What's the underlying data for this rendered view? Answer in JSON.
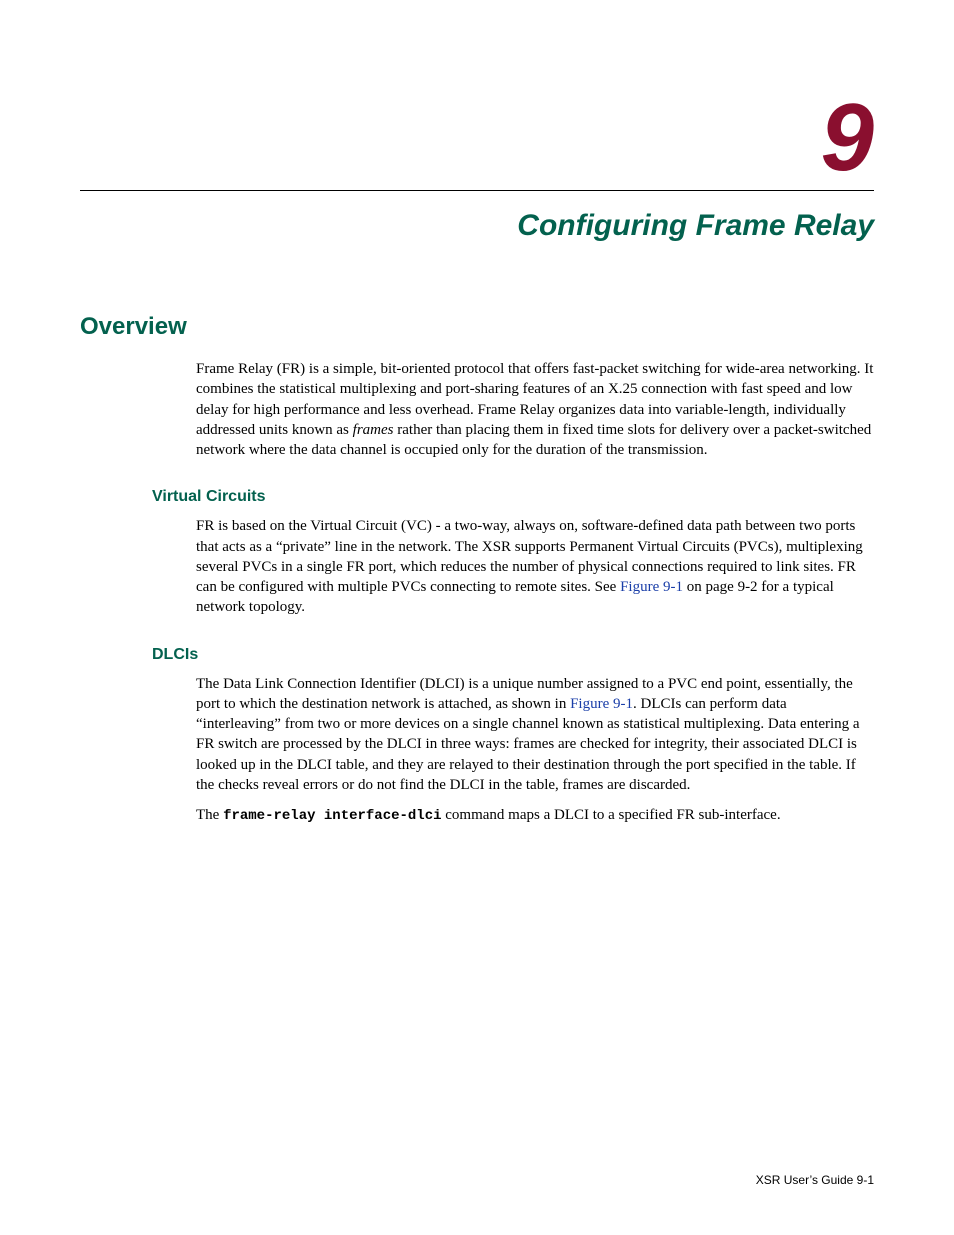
{
  "chapter": {
    "number": "9",
    "title": "Configuring Frame Relay"
  },
  "sections": {
    "overview": {
      "heading": "Overview",
      "p1a": "Frame Relay (FR) is a simple, bit-oriented protocol that offers fast-packet switching for wide-area networking. It combines the statistical multiplexing and port-sharing features of an X.25 connection with fast speed and low delay for high performance and less overhead. Frame Relay organizes data into variable-length, individually addressed units known as ",
      "p1_em": "frames",
      "p1b": " rather than placing them in fixed time slots for delivery over a packet-switched network where the data channel is occupied only for the duration of the transmission."
    },
    "vc": {
      "heading": "Virtual Circuits",
      "p1a": "FR is based on the Virtual Circuit (VC) - a two-way, always on, software-defined data path between two ports that acts as a “private” line in the network. The XSR supports Permanent Virtual Circuits (PVCs), multiplexing several PVCs in a single FR port, which reduces the number of physical connections required to link sites. FR can be configured with multiple PVCs connecting to remote sites. See ",
      "p1_link": "Figure 9-1",
      "p1b": " on page 9-2 for a typical network topology."
    },
    "dlcis": {
      "heading": "DLCIs",
      "p1a": "The Data Link Connection Identifier (DLCI) is a unique number assigned to a PVC end point, essentially, the port to which the destination network is attached, as shown in ",
      "p1_link": "Figure 9-1",
      "p1b": ". DLCIs can perform data “interleaving” from two or more devices on a single channel known as statistical multiplexing. Data entering a FR switch are processed by the DLCI in three ways: frames are checked for integrity, their associated DLCI is looked up in the DLCI table, and they are relayed to their destination through the port specified in the table. If the checks reveal errors or do not find the DLCI in the table, frames are discarded.",
      "p2a": "The ",
      "p2_code": "frame-relay interface-dlci",
      "p2b": " command maps a DLCI to a specified FR sub-interface."
    }
  },
  "footer": {
    "text": "XSR User’s Guide   9-1"
  }
}
